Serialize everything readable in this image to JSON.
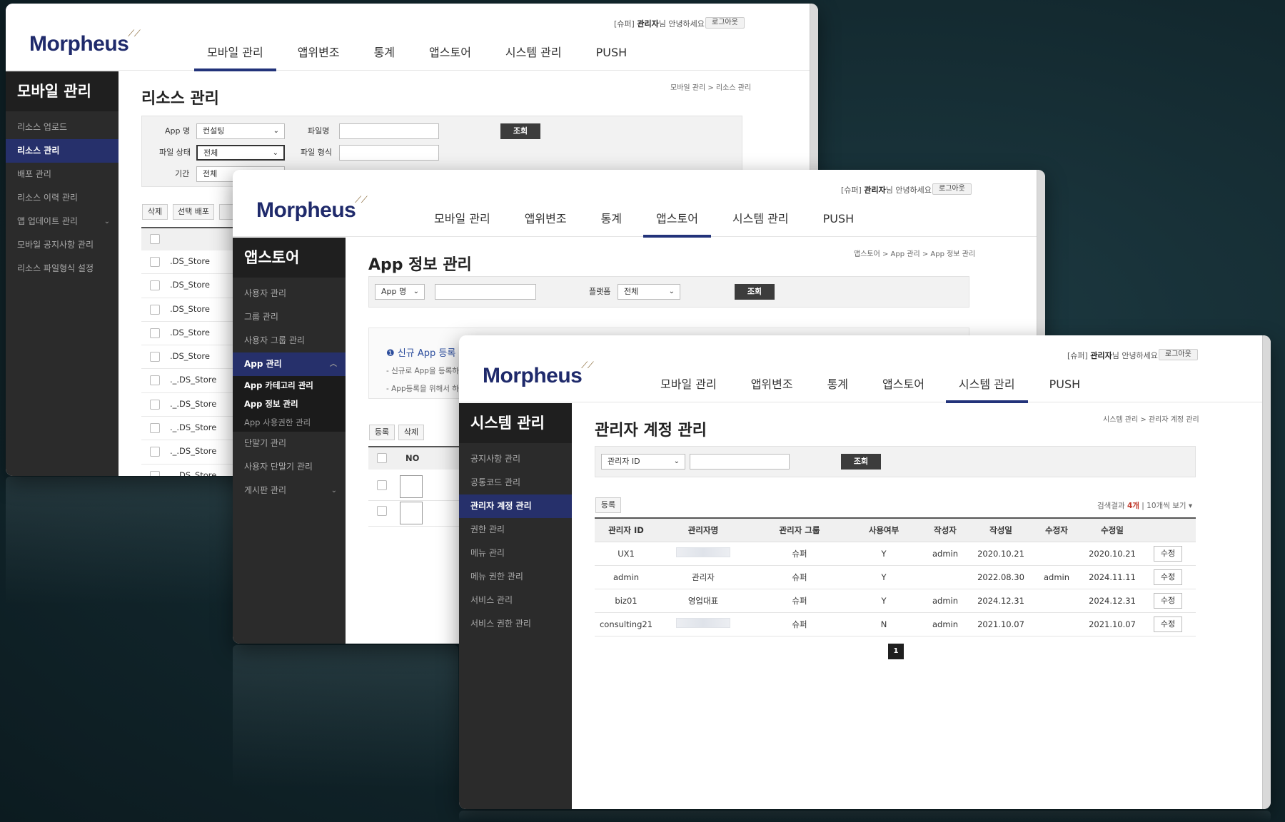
{
  "common": {
    "logo": "Morpheus",
    "welcome_prefix": "[슈퍼] ",
    "welcome_name": "관리자",
    "welcome_suffix": "님 안녕하세요!",
    "logout": "로그아웃",
    "nav": [
      "모바일 관리",
      "앱위변조",
      "통계",
      "앱스토어",
      "시스템 관리",
      "PUSH"
    ],
    "search_button": "조회",
    "dropdown_caret": "⌄"
  },
  "window1": {
    "sidebar_title": "모바일 관리",
    "sidebar_items": [
      "리소스 업로드",
      "리소스 관리",
      "배포 관리",
      "리소스 이력 관리",
      "앱 업데이트 관리",
      "모바일 공지사항 관리",
      "리소스 파일형식 설정"
    ],
    "breadcrumb": "모바일 관리 > 리소스 관리",
    "page_title": "리소스 관리",
    "labels": {
      "app": "App 명",
      "filename": "파일명",
      "status": "파일 상태",
      "type": "파일 형식",
      "period": "기간"
    },
    "values": {
      "app": "컨설팅",
      "status": "전체",
      "period": "전체"
    },
    "buttons": {
      "delete": "삭제",
      "deploy": "선택 배포"
    },
    "files": [
      ".DS_Store",
      ".DS_Store",
      ".DS_Store",
      ".DS_Store",
      ".DS_Store",
      "._.DS_Store",
      "._.DS_Store",
      "._.DS_Store",
      "._.DS_Store",
      "._.DS_Store"
    ]
  },
  "window2": {
    "sidebar_title": "앱스토어",
    "sidebar_items": [
      "사용자 관리",
      "그룹 관리",
      "사용자 그룹 관리"
    ],
    "sidebar_active": "App 관리",
    "sidebar_subitems": [
      "App 카테고리 관리",
      "App 정보 관리",
      "App 사용권한 관리"
    ],
    "sidebar_items_after": [
      "단말기 관리",
      "사용자 단말기 관리",
      "게시판 관리"
    ],
    "breadcrumb": "앱스토어 > App 관리 > App 정보 관리",
    "page_title": "App 정보 관리",
    "search_select": "App 명",
    "platform_label": "플랫폼",
    "platform_value": "전체",
    "notice_title": "신규 App 등록",
    "notice_lines": [
      "- 신규로 App을 등록하",
      "- App등록을 위해서 하"
    ],
    "buttons": {
      "register": "등록",
      "delete": "삭제"
    },
    "table_header_no": "NO"
  },
  "window3": {
    "sidebar_title": "시스템 관리",
    "sidebar_items": [
      "공지사항 관리",
      "공통코드 관리",
      "관리자 계정 관리",
      "권한 관리",
      "메뉴 관리",
      "메뉴 권한 관리",
      "서비스 관리",
      "서비스 권한 관리"
    ],
    "breadcrumb": "시스템 관리 > 관리자 계정 관리",
    "page_title": "관리자 계정 관리",
    "search_select": "관리자 ID",
    "register_button": "등록",
    "result_prefix": "검색결과 ",
    "result_count": "4개",
    "result_sep": " | ",
    "per_page": "10개씩 보기 ▾",
    "columns": [
      "관리자 ID",
      "관리자명",
      "관리자 그룹",
      "사용여부",
      "작성자",
      "작성일",
      "수정자",
      "수정일",
      ""
    ],
    "rows": [
      {
        "id": "UX1",
        "name": "",
        "group": "슈퍼",
        "use": "Y",
        "writer": "admin",
        "created": "2020.10.21",
        "editor": "",
        "updated": "2020.10.21",
        "action": "수정"
      },
      {
        "id": "admin",
        "name": "관리자",
        "group": "슈퍼",
        "use": "Y",
        "writer": "",
        "created": "2022.08.30",
        "editor": "admin",
        "updated": "2024.11.11",
        "action": "수정"
      },
      {
        "id": "biz01",
        "name": "영업대표",
        "group": "슈퍼",
        "use": "Y",
        "writer": "admin",
        "created": "2024.12.31",
        "editor": "",
        "updated": "2024.12.31",
        "action": "수정"
      },
      {
        "id": "consulting21",
        "name": "",
        "group": "슈퍼",
        "use": "N",
        "writer": "admin",
        "created": "2021.10.07",
        "editor": "",
        "updated": "2021.10.07",
        "action": "수정"
      }
    ],
    "page": "1"
  }
}
